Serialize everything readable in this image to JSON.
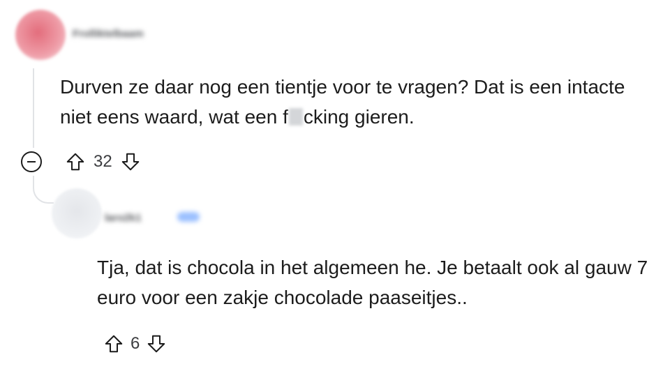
{
  "comment": {
    "author": "Frolliktelbaam",
    "body_part1": "Durven ze daar nog een tientje voor te vragen? Dat is een intacte niet eens waard, wat een f",
    "body_part2": "cking gieren.",
    "score": "32",
    "collapse_icon": "minus-circle-icon",
    "upvote_icon": "arrow-up-outline-icon",
    "downvote_icon": "arrow-down-outline-icon"
  },
  "reply": {
    "author": "laro2k1",
    "body": "Tja, dat is chocola in het algemeen he. Je betaalt ook al gauw 7 euro voor een zakje chocolade paaseitjes..",
    "score": "6",
    "upvote_icon": "arrow-up-outline-icon",
    "downvote_icon": "arrow-down-outline-icon"
  },
  "colors": {
    "text": "#1c1c1c",
    "meta": "#3c3d40",
    "rail": "#e1e3e6",
    "op_avatar": "#e36d7c"
  }
}
